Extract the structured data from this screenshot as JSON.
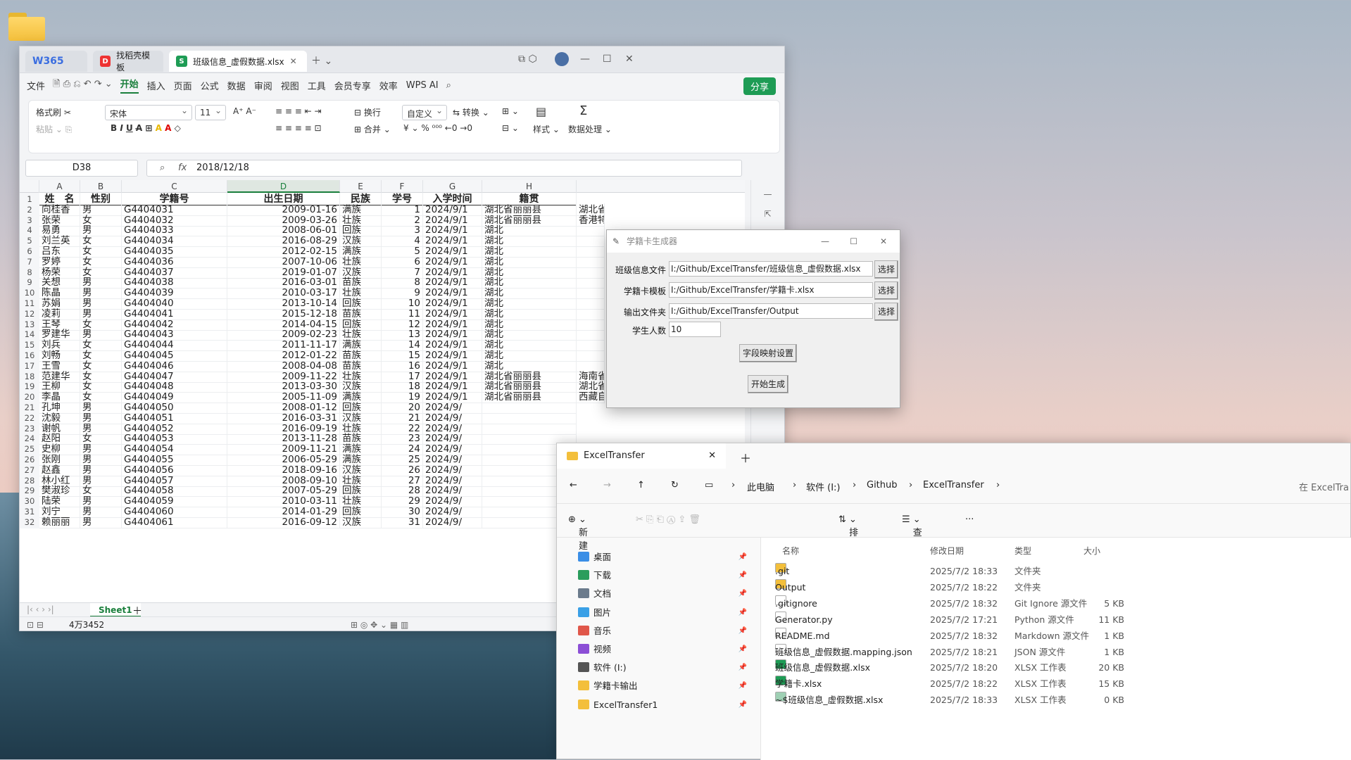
{
  "wps": {
    "tabs": [
      {
        "label": "W365"
      },
      {
        "label": "找稻壳模板"
      },
      {
        "label": "班级信息_虚假数据.xlsx"
      }
    ],
    "menu": [
      "文件",
      "开始",
      "插入",
      "页面",
      "公式",
      "数据",
      "审阅",
      "视图",
      "工具",
      "会员专享",
      "效率",
      "WPS AI"
    ],
    "share": "分享",
    "ribbon": {
      "format_painter": "格式刷",
      "paste": "粘贴",
      "font": "宋体",
      "size": "11",
      "wrap": "换行",
      "merge": "合并",
      "number_format": "自定义",
      "convert": "转换",
      "styles": "样式",
      "data_proc": "数据处理"
    },
    "namebox": "D38",
    "formula": "2018/12/18",
    "fx": "fx",
    "columns": [
      "A",
      "B",
      "C",
      "D",
      "E",
      "F",
      "G",
      "H"
    ],
    "headers": [
      "姓　名",
      "性别",
      "学籍号",
      "出生日期",
      "民族",
      "学号",
      "入学时间",
      "籍贯"
    ],
    "rows": [
      [
        "向桂香",
        "男",
        "G4404031",
        "2009-01-16",
        "满族",
        "1",
        "2024/9/1",
        "湖北省丽丽县",
        "湖北省"
      ],
      [
        "张荣",
        "女",
        "G4404032",
        "2009-03-26",
        "壮族",
        "2",
        "2024/9/1",
        "湖北省丽丽县",
        "香港特"
      ],
      [
        "易勇",
        "男",
        "G4404033",
        "2008-06-01",
        "回族",
        "3",
        "2024/9/1",
        "湖北",
        ""
      ],
      [
        "刘兰英",
        "女",
        "G4404034",
        "2016-08-29",
        "汉族",
        "4",
        "2024/9/1",
        "湖北",
        ""
      ],
      [
        "吕东",
        "女",
        "G4404035",
        "2012-02-15",
        "满族",
        "5",
        "2024/9/1",
        "湖北",
        ""
      ],
      [
        "罗婷",
        "女",
        "G4404036",
        "2007-10-06",
        "壮族",
        "6",
        "2024/9/1",
        "湖北",
        ""
      ],
      [
        "杨荣",
        "女",
        "G4404037",
        "2019-01-07",
        "汉族",
        "7",
        "2024/9/1",
        "湖北",
        ""
      ],
      [
        "关想",
        "男",
        "G4404038",
        "2016-03-01",
        "苗族",
        "8",
        "2024/9/1",
        "湖北",
        ""
      ],
      [
        "陈晶",
        "男",
        "G4404039",
        "2010-03-17",
        "壮族",
        "9",
        "2024/9/1",
        "湖北",
        ""
      ],
      [
        "苏娟",
        "男",
        "G4404040",
        "2013-10-14",
        "回族",
        "10",
        "2024/9/1",
        "湖北",
        ""
      ],
      [
        "凌莉",
        "男",
        "G4404041",
        "2015-12-18",
        "苗族",
        "11",
        "2024/9/1",
        "湖北",
        ""
      ],
      [
        "王琴",
        "女",
        "G4404042",
        "2014-04-15",
        "回族",
        "12",
        "2024/9/1",
        "湖北",
        ""
      ],
      [
        "罗建华",
        "男",
        "G4404043",
        "2009-02-23",
        "壮族",
        "13",
        "2024/9/1",
        "湖北",
        ""
      ],
      [
        "刘兵",
        "女",
        "G4404044",
        "2011-11-17",
        "满族",
        "14",
        "2024/9/1",
        "湖北",
        ""
      ],
      [
        "刘畅",
        "女",
        "G4404045",
        "2012-01-22",
        "苗族",
        "15",
        "2024/9/1",
        "湖北",
        ""
      ],
      [
        "王雪",
        "女",
        "G4404046",
        "2008-04-08",
        "苗族",
        "16",
        "2024/9/1",
        "湖北",
        ""
      ],
      [
        "范建华",
        "女",
        "G4404047",
        "2009-11-22",
        "壮族",
        "17",
        "2024/9/1",
        "湖北省丽丽县",
        "海南省"
      ],
      [
        "王柳",
        "女",
        "G4404048",
        "2013-03-30",
        "汉族",
        "18",
        "2024/9/1",
        "湖北省丽丽县",
        "湖北省"
      ],
      [
        "李晶",
        "女",
        "G4404049",
        "2005-11-09",
        "满族",
        "19",
        "2024/9/1",
        "湖北省丽丽县",
        "西藏自"
      ],
      [
        "孔坤",
        "男",
        "G4404050",
        "2008-01-12",
        "回族",
        "20",
        "2024/9/",
        ""
      ],
      [
        "沈毅",
        "男",
        "G4404051",
        "2016-03-31",
        "汉族",
        "21",
        "2024/9/",
        ""
      ],
      [
        "谢帆",
        "男",
        "G4404052",
        "2016-09-19",
        "壮族",
        "22",
        "2024/9/",
        ""
      ],
      [
        "赵阳",
        "女",
        "G4404053",
        "2013-11-28",
        "苗族",
        "23",
        "2024/9/",
        ""
      ],
      [
        "史柳",
        "男",
        "G4404054",
        "2009-11-21",
        "满族",
        "24",
        "2024/9/",
        ""
      ],
      [
        "张刚",
        "男",
        "G4404055",
        "2006-05-29",
        "满族",
        "25",
        "2024/9/",
        ""
      ],
      [
        "赵鑫",
        "男",
        "G4404056",
        "2018-09-16",
        "汉族",
        "26",
        "2024/9/",
        ""
      ],
      [
        "林小红",
        "男",
        "G4404057",
        "2008-09-10",
        "壮族",
        "27",
        "2024/9/",
        ""
      ],
      [
        "樊淑珍",
        "女",
        "G4404058",
        "2007-05-29",
        "回族",
        "28",
        "2024/9/",
        ""
      ],
      [
        "陆荣",
        "男",
        "G4404059",
        "2010-03-11",
        "壮族",
        "29",
        "2024/9/",
        ""
      ],
      [
        "刘宁",
        "男",
        "G4404060",
        "2014-01-29",
        "回族",
        "30",
        "2024/9/",
        ""
      ],
      [
        "赖丽丽",
        "男",
        "G4404061",
        "2016-09-12",
        "汉族",
        "31",
        "2024/9/",
        ""
      ]
    ],
    "sheet": "Sheet1",
    "status_count": "4万3452"
  },
  "dialog": {
    "title": "学籍卡生成器",
    "labels": [
      "班级信息文件",
      "学籍卡模板",
      "输出文件夹",
      "学生人数"
    ],
    "values": [
      "I:/Github/ExcelTransfer/班级信息_虚假数据.xlsx",
      "I:/Github/ExcelTransfer/学籍卡.xlsx",
      "I:/Github/ExcelTransfer/Output",
      "10"
    ],
    "choose": "选择",
    "mapping_btn": "字段映射设置",
    "start_btn": "开始生成"
  },
  "explorer": {
    "tab": "ExcelTransfer",
    "breadcrumb": [
      "此电脑",
      "软件 (I:)",
      "Github",
      "ExcelTransfer"
    ],
    "search": "在 ExcelTra",
    "toolbar": {
      "new": "新建",
      "sort": "排序",
      "view": "查看"
    },
    "nav": [
      "桌面",
      "下载",
      "文档",
      "图片",
      "音乐",
      "视频",
      "软件 (I:)",
      "学籍卡输出",
      "ExcelTransfer1"
    ],
    "headers": [
      "名称",
      "修改日期",
      "类型",
      "大小"
    ],
    "files": [
      {
        "name": ".git",
        "date": "2025/7/2 18:33",
        "type": "文件夹",
        "size": ""
      },
      {
        "name": "Output",
        "date": "2025/7/2 18:22",
        "type": "文件夹",
        "size": ""
      },
      {
        "name": ".gitignore",
        "date": "2025/7/2 18:32",
        "type": "Git Ignore 源文件",
        "size": "5 KB"
      },
      {
        "name": "Generator.py",
        "date": "2025/7/2 17:21",
        "type": "Python 源文件",
        "size": "11 KB"
      },
      {
        "name": "README.md",
        "date": "2025/7/2 18:32",
        "type": "Markdown 源文件",
        "size": "1 KB"
      },
      {
        "name": "班级信息_虚假数据.mapping.json",
        "date": "2025/7/2 18:21",
        "type": "JSON 源文件",
        "size": "1 KB"
      },
      {
        "name": "班级信息_虚假数据.xlsx",
        "date": "2025/7/2 18:20",
        "type": "XLSX 工作表",
        "size": "20 KB"
      },
      {
        "name": "学籍卡.xlsx",
        "date": "2025/7/2 18:22",
        "type": "XLSX 工作表",
        "size": "15 KB"
      },
      {
        "name": "~$班级信息_虚假数据.xlsx",
        "date": "2025/7/2 18:33",
        "type": "XLSX 工作表",
        "size": "0 KB"
      }
    ]
  },
  "colors": {
    "accent": "#1a7f3c",
    "share": "#1e9c55"
  }
}
